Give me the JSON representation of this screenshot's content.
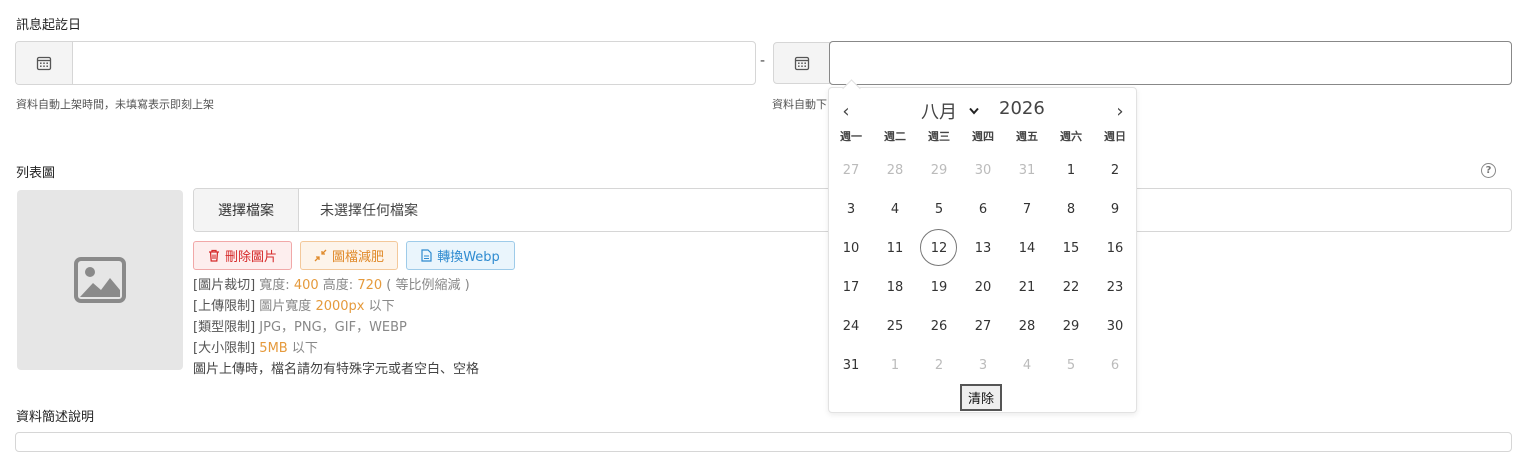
{
  "date_range": {
    "label": "訊息起訖日",
    "separator": "-",
    "start": {
      "value": "",
      "hint": "資料自動上架時間，未填寫表示即刻上架"
    },
    "end": {
      "value": "",
      "hint_visible": "資料自動下"
    }
  },
  "list_image": {
    "label": "列表圖",
    "choose_file": "選擇檔案",
    "no_file": "未選擇任何檔案",
    "buttons": {
      "delete": "刪除圖片",
      "compress": "圖檔減肥",
      "webp": "轉換Webp"
    },
    "rules": {
      "crop_tag": "[圖片裁切]",
      "crop_width_label": "寬度:",
      "crop_width": "400",
      "crop_height_label": "高度:",
      "crop_height": "720",
      "crop_note": "( 等比例縮減 )",
      "upload_tag": "[上傳限制]",
      "upload_label": "圖片寬度",
      "upload_value": "2000px",
      "upload_suffix": "以下",
      "type_tag": "[類型限制]",
      "type_value": "JPG，PNG，GIF，WEBP",
      "size_tag": "[大小限制]",
      "size_value": "5MB",
      "size_suffix": "以下",
      "filename_note": "圖片上傳時，檔名請勿有特殊字元或者空白、空格"
    }
  },
  "summary": {
    "label": "資料簡述說明"
  },
  "datepicker": {
    "prev": "‹",
    "next": "›",
    "month": "八月",
    "year": "2026",
    "weekdays": [
      "週一",
      "週二",
      "週三",
      "週四",
      "週五",
      "週六",
      "週日"
    ],
    "weeks": [
      [
        "27",
        "28",
        "29",
        "30",
        "31",
        "1",
        "2"
      ],
      [
        "3",
        "4",
        "5",
        "6",
        "7",
        "8",
        "9"
      ],
      [
        "10",
        "11",
        "12",
        "13",
        "14",
        "15",
        "16"
      ],
      [
        "17",
        "18",
        "19",
        "20",
        "21",
        "22",
        "23"
      ],
      [
        "24",
        "25",
        "26",
        "27",
        "28",
        "29",
        "30"
      ],
      [
        "31",
        "1",
        "2",
        "3",
        "4",
        "5",
        "6"
      ]
    ],
    "muted": [
      [
        0,
        0
      ],
      [
        0,
        1
      ],
      [
        0,
        2
      ],
      [
        0,
        3
      ],
      [
        0,
        4
      ],
      [
        5,
        1
      ],
      [
        5,
        2
      ],
      [
        5,
        3
      ],
      [
        5,
        4
      ],
      [
        5,
        5
      ],
      [
        5,
        6
      ]
    ],
    "today": [
      2,
      2
    ],
    "clear": "清除"
  },
  "colors": {
    "highlight": "#e59a3c",
    "danger": "#d62b2b",
    "warn": "#e08a2a",
    "info": "#2f8bd0"
  },
  "icons": {
    "calendar": "calendar-icon",
    "image": "image-placeholder-icon",
    "trash": "trash-icon",
    "compress": "compress-icon",
    "file": "file-icon",
    "help": "help-icon"
  }
}
